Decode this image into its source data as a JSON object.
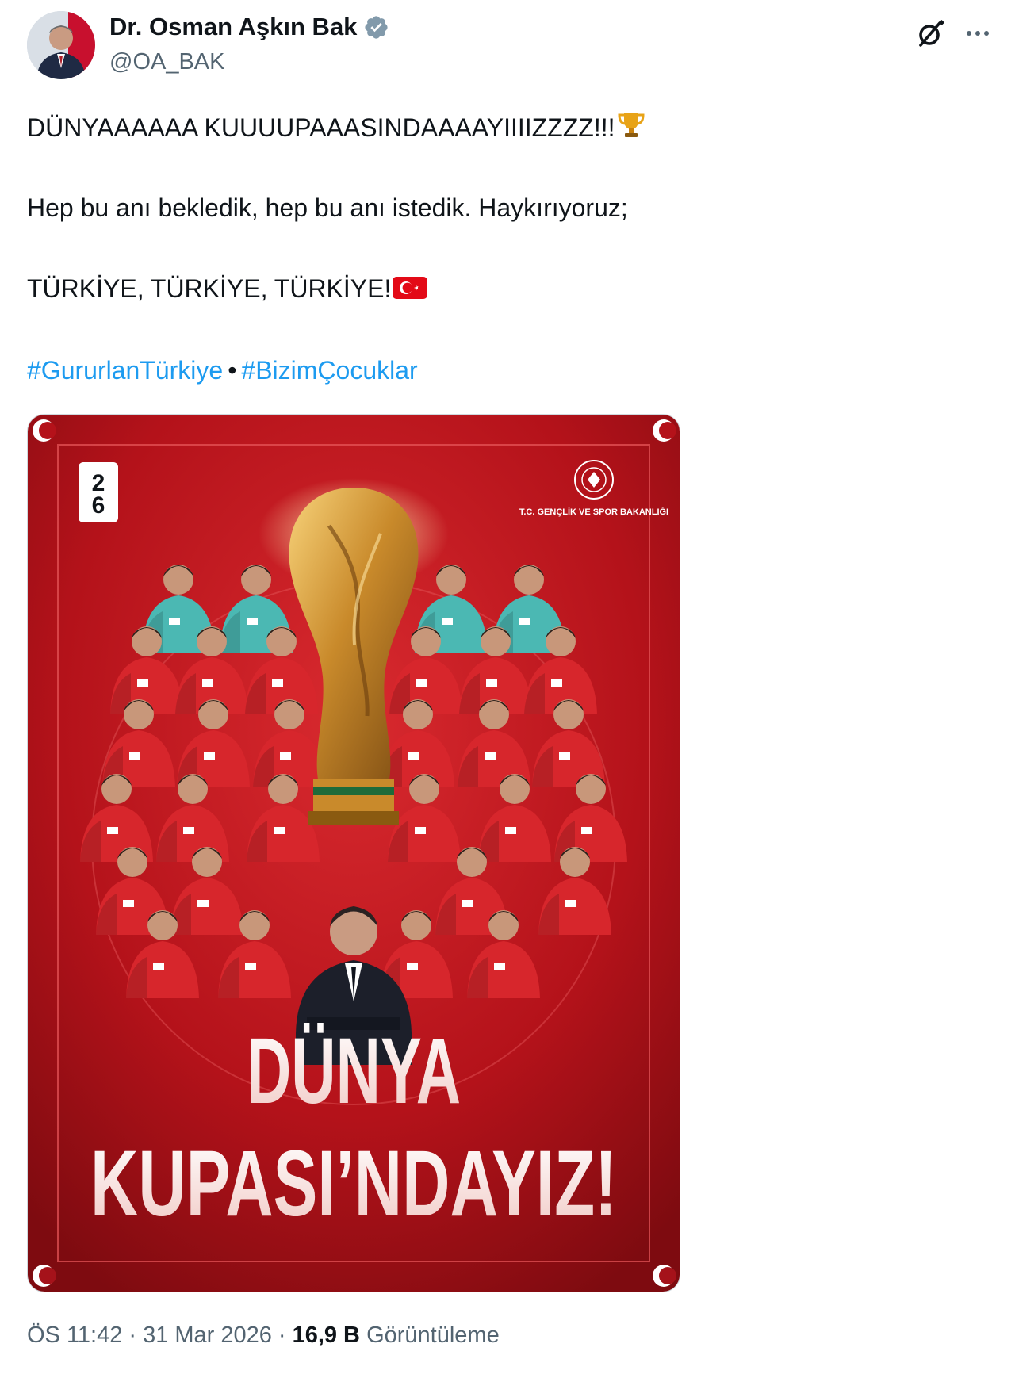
{
  "author": {
    "name": "Dr. Osman Aşkın Bak",
    "handle": "@OA_BAK",
    "verified": true
  },
  "tweet": {
    "line1": "DÜNYAAAAAA KUUUUPAAASINDAAAAYIIIIZZZZ!!!",
    "line1_emoji": "trophy-icon",
    "line2": "Hep bu anı bekledik, hep bu anı istedik. Haykırıyoruz;",
    "line3": "TÜRKİYE, TÜRKİYE, TÜRKİYE!",
    "line3_emoji": "turkey-flag-icon",
    "hashtags": [
      "#GururlanTürkiye",
      "#BizimÇocuklar"
    ],
    "hashtag_separator": "•"
  },
  "media": {
    "poster_line1": "DÜNYA",
    "poster_line2": "KUPASI’NDAYIZ!",
    "ministry_logo_text": "T.C. GENÇLİK VE SPOR BAKANLIĞI",
    "background_color": "#b8141a"
  },
  "meta": {
    "time": "ÖS 11:42",
    "date": "31 Mar 2026",
    "views_count": "16,9 B",
    "views_label": "Görüntüleme",
    "separator": "·"
  },
  "colors": {
    "link": "#1d9bf0",
    "text": "#0f1419",
    "secondary": "#536471",
    "verified_badge": "#829aab"
  }
}
